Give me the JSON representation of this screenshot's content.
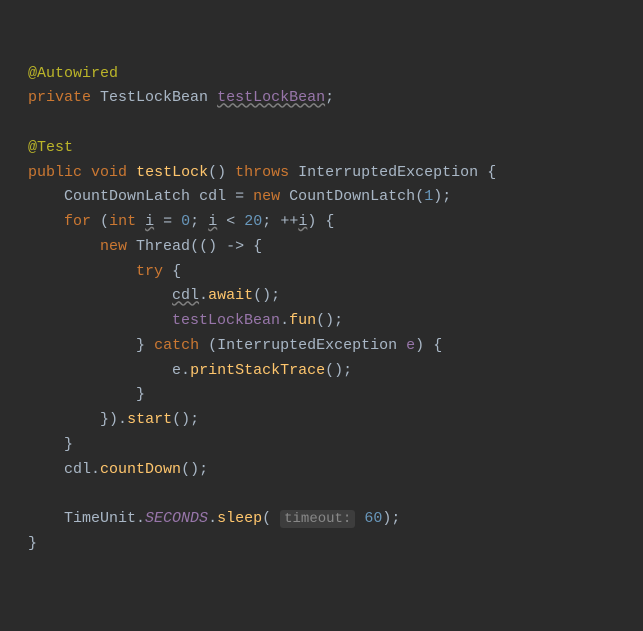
{
  "line1": {
    "anno": "@Autowired"
  },
  "line2": {
    "kw1": "private",
    "type": "TestLockBean",
    "field": "testLockBean",
    "semi": ";"
  },
  "line3": {
    "anno": "@Test"
  },
  "line4": {
    "kw1": "public",
    "kw2": "void",
    "fn": "testLock",
    "par": "()",
    "kw3": "throws",
    "exc": "InterruptedException",
    "brace": "{"
  },
  "line5": {
    "type": "CountDownLatch",
    "var": "cdl",
    "eq": "=",
    "kw": "new",
    "type2": "CountDownLatch",
    "lp": "(",
    "num": "1",
    "rp": ")",
    "semi": ";"
  },
  "line6": {
    "kw": "for",
    "lp": "(",
    "kw2": "int",
    "var": "i",
    "eq": "=",
    "num0": "0",
    "semi1": ";",
    "var2": "i",
    "lt": "<",
    "num20": "20",
    "semi2": ";",
    "inc": "++",
    "var3": "i",
    "rp": ")",
    "brace": "{"
  },
  "line7": {
    "kw": "new",
    "type": "Thread",
    "lp": "(",
    "par": "()",
    "arrow": "->",
    "brace": "{"
  },
  "line8": {
    "kw": "try",
    "brace": "{"
  },
  "line9": {
    "var": "cdl",
    "dot": ".",
    "fn": "await",
    "par": "()",
    "semi": ";"
  },
  "line10": {
    "field": "testLockBean",
    "dot": ".",
    "fn": "fun",
    "par": "()",
    "semi": ";"
  },
  "line11": {
    "rb": "}",
    "kw": "catch",
    "lp": "(",
    "type": "InterruptedException",
    "var": "e",
    "rp": ")",
    "brace": "{"
  },
  "line12": {
    "var": "e",
    "dot": ".",
    "fn": "printStackTrace",
    "par": "()",
    "semi": ";"
  },
  "line13": {
    "rb": "}"
  },
  "line14": {
    "rb": "}",
    "rp": ")",
    "dot": ".",
    "fn": "start",
    "par": "()",
    "semi": ";"
  },
  "line15": {
    "rb": "}"
  },
  "line16": {
    "var": "cdl",
    "dot": ".",
    "fn": "countDown",
    "par": "()",
    "semi": ";"
  },
  "line17": {
    "type": "TimeUnit",
    "dot": ".",
    "field": "SECONDS",
    "dot2": ".",
    "fn": "sleep",
    "lp": "(",
    "hint": "timeout:",
    "sp": " ",
    "num": "60",
    "rp": ")",
    "semi": ";"
  },
  "line18": {
    "rb": "}"
  }
}
